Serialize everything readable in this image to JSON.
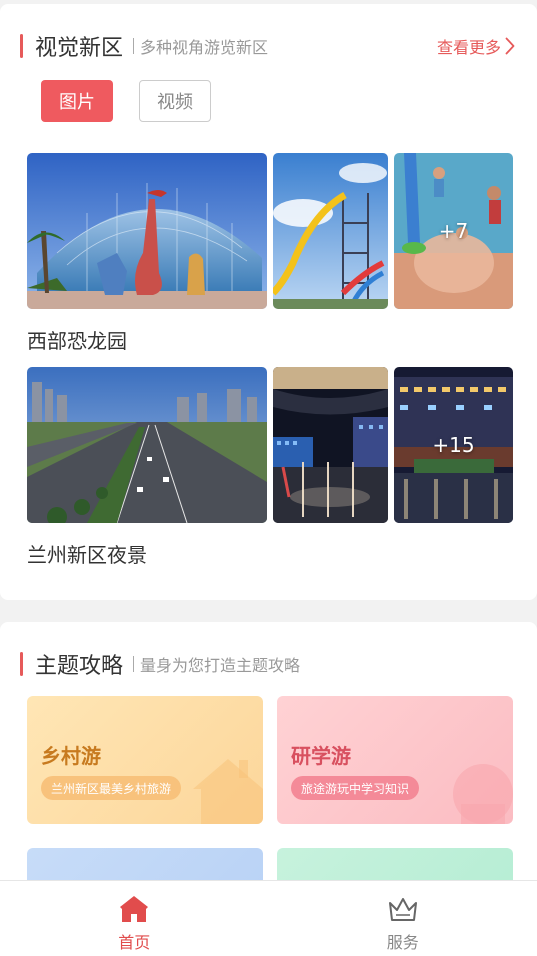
{
  "visual": {
    "title": "视觉新区",
    "subtitle": "多种视角游览新区",
    "more_label": "查看更多",
    "tabs": [
      {
        "label": "图片",
        "active": true
      },
      {
        "label": "视频",
        "active": false
      }
    ],
    "albums": [
      {
        "caption": "西部恐龙园",
        "more_count": "+7",
        "photos": [
          "dinosaur-park-dome",
          "water-slide-tower",
          "kids-water-play"
        ]
      },
      {
        "caption": "兰州新区夜景",
        "more_count": "+15",
        "photos": [
          "city-avenue-aerial",
          "night-plaza-lights",
          "night-mall-reflections"
        ]
      }
    ]
  },
  "theme": {
    "title": "主题攻略",
    "subtitle": "量身为您打造主题攻略",
    "tiles": [
      {
        "title": "乡村游",
        "tag": "兰州新区最美乡村旅游",
        "color": "#f5a233"
      },
      {
        "title": "研学游",
        "tag": "旅途游玩中学习知识",
        "color": "#ec6a7c"
      }
    ]
  },
  "tabbar": {
    "items": [
      {
        "label": "首页",
        "icon": "home-icon",
        "active": true
      },
      {
        "label": "服务",
        "icon": "crown-icon",
        "active": false
      }
    ]
  },
  "colors": {
    "accent": "#e65a5a",
    "tab_active": "#ef5a5f"
  }
}
